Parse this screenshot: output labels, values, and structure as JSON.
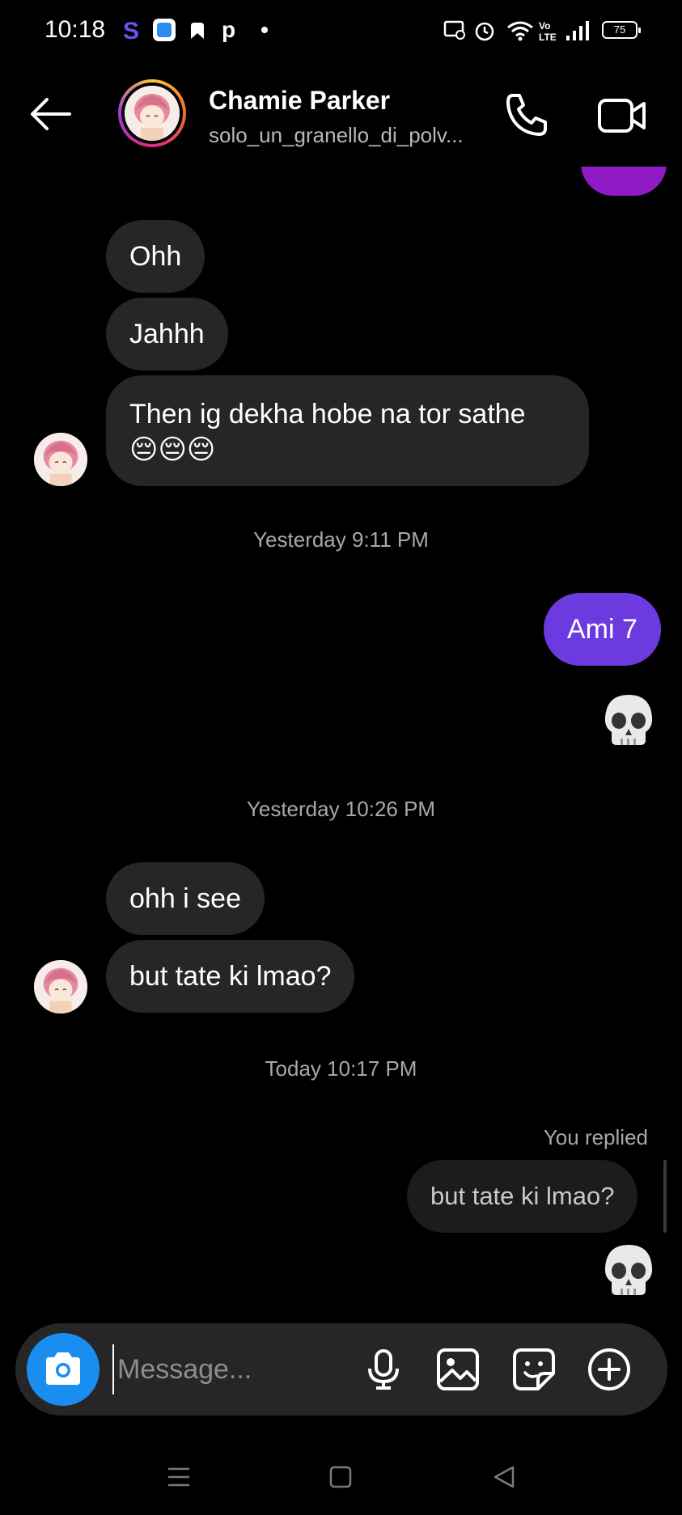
{
  "status_bar": {
    "time": "10:18",
    "battery": "75"
  },
  "header": {
    "contact_name": "Chamie Parker",
    "username": "solo_un_granello_di_polv..."
  },
  "messages": {
    "m1": "Ohh",
    "m2": "Jahhh",
    "m3_line1": "Then ig dekha hobe na tor sathe",
    "m3_emoji": "😔😔😔",
    "ts1": "Yesterday 9:11 PM",
    "m4": "Ami 7",
    "ts2": "Yesterday 10:26 PM",
    "m5": "ohh i see",
    "m6": "but tate ki lmao?",
    "ts3": "Today 10:17 PM",
    "you_replied": "You replied",
    "reply_quote": "but tate ki lmao?"
  },
  "composer": {
    "placeholder": "Message..."
  },
  "colors": {
    "outgoing_bubble": "#6c3be0",
    "incoming_bubble": "#262626",
    "camera_button": "#1a8df0"
  }
}
